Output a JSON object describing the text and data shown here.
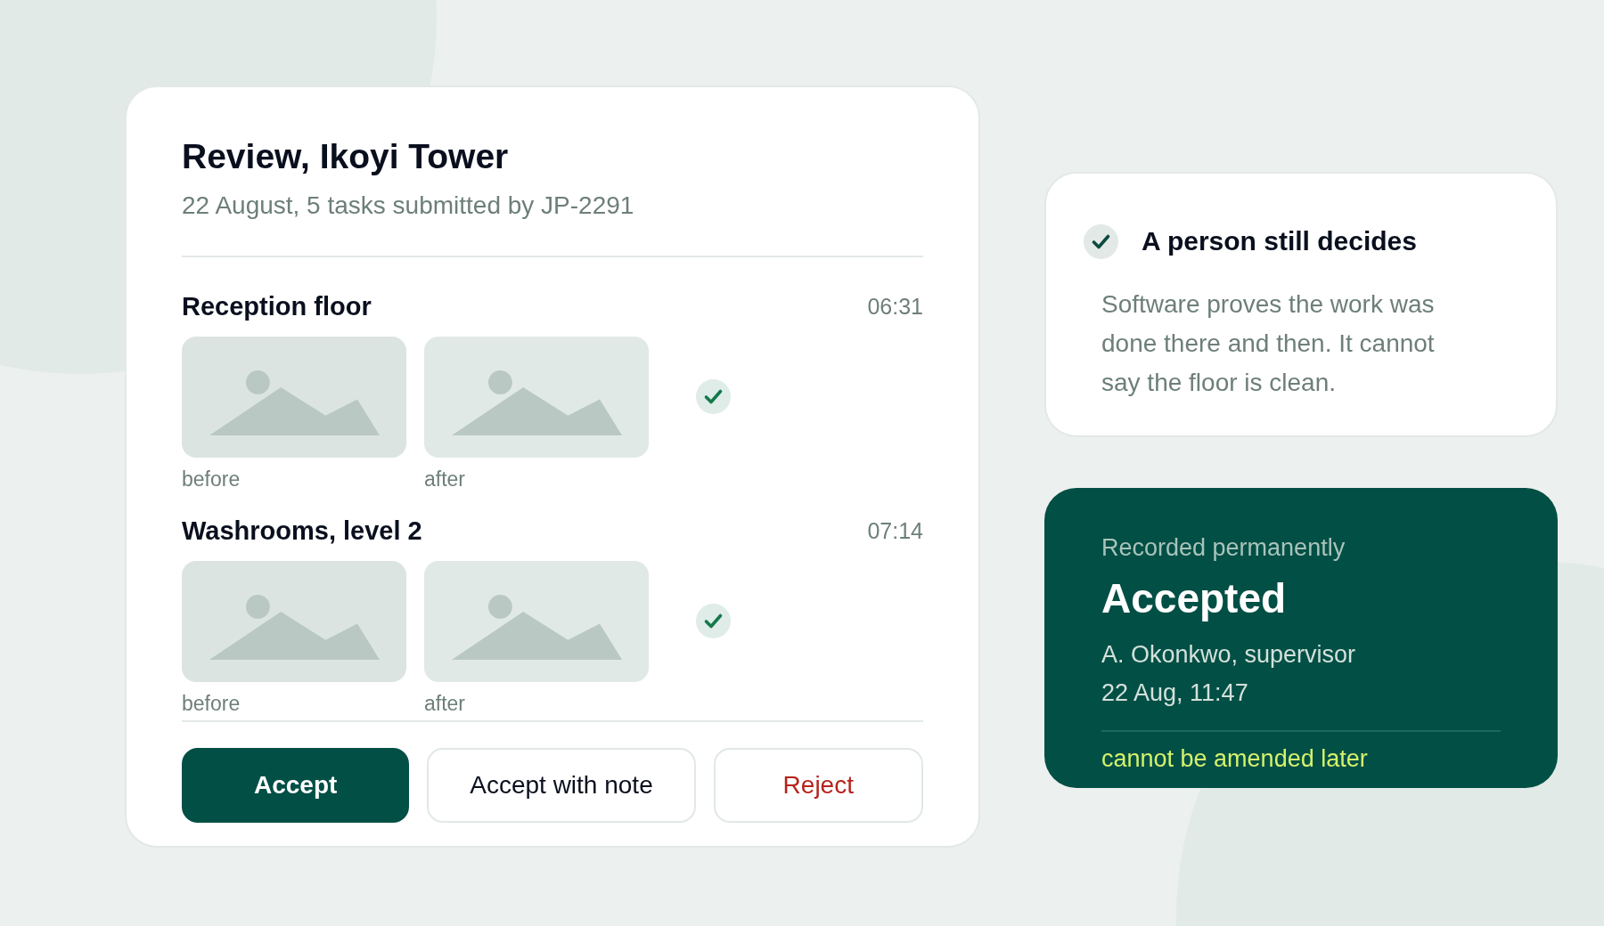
{
  "review": {
    "title": "Review, Ikoyi Tower",
    "subtitle": "22 August, 5 tasks submitted by JP-2291",
    "tasks": [
      {
        "name": "Reception floor",
        "time": "06:31",
        "photos": [
          {
            "caption": "before"
          },
          {
            "caption": "after"
          }
        ],
        "verified": true
      },
      {
        "name": "Washrooms, level 2",
        "time": "07:14",
        "photos": [
          {
            "caption": "before"
          },
          {
            "caption": "after"
          }
        ],
        "verified": true
      }
    ],
    "actions": [
      {
        "label": "Accept",
        "kind": "primary"
      },
      {
        "label": "Accept with note",
        "kind": "secondary"
      },
      {
        "label": "Reject",
        "kind": "danger"
      }
    ]
  },
  "note": {
    "heading": "A person still decides",
    "body": "Software proves the work was done there and then. It cannot say the floor is clean."
  },
  "decision": {
    "eyebrow": "Recorded permanently",
    "status": "Accepted",
    "lines": [
      "A. Okonkwo, supervisor",
      "22 Aug, 11:47"
    ],
    "footnote": "cannot be amended later"
  }
}
